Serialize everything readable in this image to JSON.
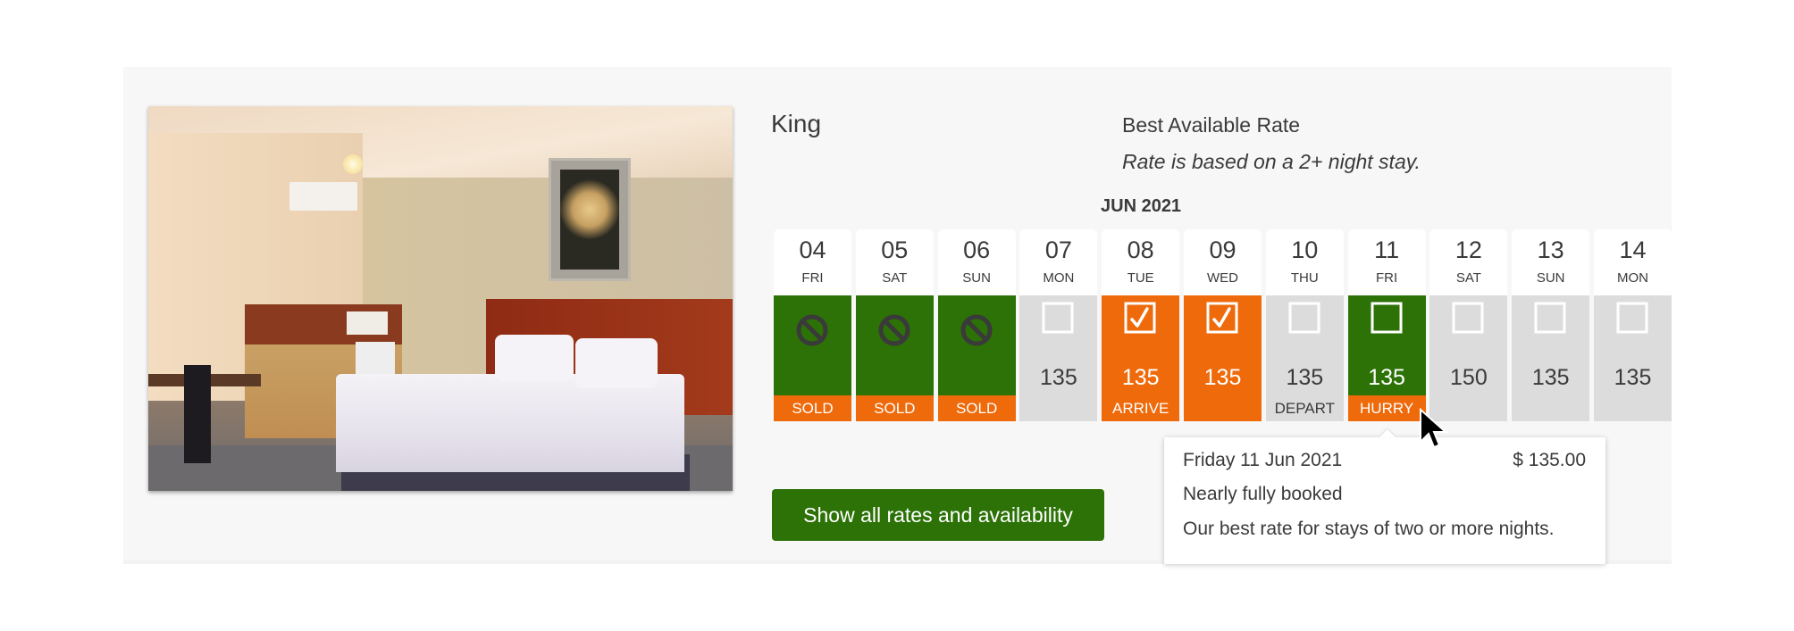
{
  "room": {
    "title": "King",
    "photo_alt": "hotel-room-photo"
  },
  "rate": {
    "name": "Best Available Rate",
    "note": "Rate is based on a 2+ night stay."
  },
  "calendar": {
    "month_label": "JUN 2021",
    "days": [
      {
        "num": "04",
        "dow": "FRI",
        "price": "",
        "status": "sold",
        "icon": "no-entry-icon",
        "tag": "SOLD",
        "color": "green"
      },
      {
        "num": "05",
        "dow": "SAT",
        "price": "",
        "status": "sold",
        "icon": "no-entry-icon",
        "tag": "SOLD",
        "color": "green"
      },
      {
        "num": "06",
        "dow": "SUN",
        "price": "",
        "status": "sold",
        "icon": "no-entry-icon",
        "tag": "SOLD",
        "color": "green"
      },
      {
        "num": "07",
        "dow": "MON",
        "price": "135",
        "status": "available",
        "icon": "checkbox-empty-icon",
        "tag": "",
        "color": "grey"
      },
      {
        "num": "08",
        "dow": "TUE",
        "price": "135",
        "status": "selected",
        "icon": "checkbox-checked-icon",
        "tag": "ARRIVE",
        "color": "orange"
      },
      {
        "num": "09",
        "dow": "WED",
        "price": "135",
        "status": "selected",
        "icon": "checkbox-checked-icon",
        "tag": "",
        "color": "orange"
      },
      {
        "num": "10",
        "dow": "THU",
        "price": "135",
        "status": "available",
        "icon": "checkbox-empty-icon",
        "tag": "DEPART",
        "color": "grey"
      },
      {
        "num": "11",
        "dow": "FRI",
        "price": "135",
        "status": "limited",
        "icon": "checkbox-empty-icon",
        "tag": "HURRY",
        "color": "green"
      },
      {
        "num": "12",
        "dow": "SAT",
        "price": "150",
        "status": "available",
        "icon": "checkbox-empty-icon",
        "tag": "",
        "color": "grey"
      },
      {
        "num": "13",
        "dow": "SUN",
        "price": "135",
        "status": "available",
        "icon": "checkbox-empty-icon",
        "tag": "",
        "color": "grey"
      },
      {
        "num": "14",
        "dow": "MON",
        "price": "135",
        "status": "available",
        "icon": "checkbox-empty-icon",
        "tag": "",
        "color": "grey"
      }
    ]
  },
  "actions": {
    "show_all_label": "Show all rates and availability"
  },
  "tooltip": {
    "date": "Friday 11 Jun 2021",
    "price": "$ 135.00",
    "status": "Nearly fully booked",
    "description": "Our best rate for stays of two or more nights."
  },
  "colors": {
    "green": "#2c7207",
    "orange": "#ee6a0a",
    "grey": "#dcdcdc",
    "panel_bg": "#f7f7f7",
    "text": "#3a3a3a"
  }
}
